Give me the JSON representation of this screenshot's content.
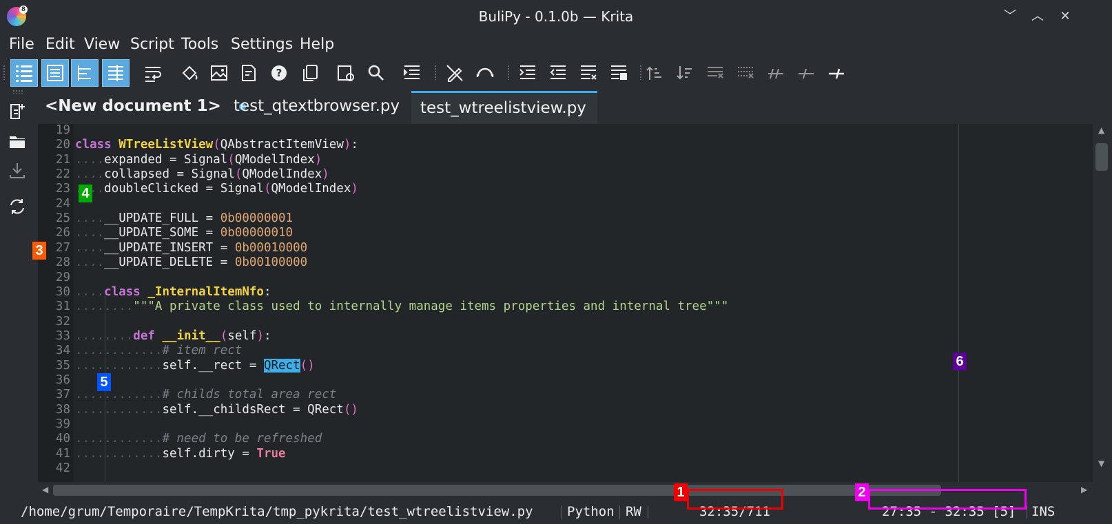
{
  "window": {
    "title": "BuliPy - 0.1.0b — Krita",
    "logo_badge": "8",
    "controls": {
      "minimize": "﹀",
      "maximize": "︿",
      "close": "✕"
    }
  },
  "menu": [
    "File",
    "Edit",
    "View",
    "Script",
    "Tools",
    "Settings",
    "Help"
  ],
  "toolbar": {
    "icons": [
      "outline-view-icon",
      "document-list-icon",
      "structure-view-icon",
      "split-view-icon",
      "word-wrap-icon",
      "paint-bucket-icon",
      "image-icon",
      "document-edit-icon",
      "help-icon",
      "copy-icon",
      "settings-document-icon",
      "search-icon",
      "sort-lines-icon",
      "no-edit-icon",
      "redo-curve-icon",
      "indent-icon",
      "unindent-icon",
      "format-list-icon",
      "format-lines-icon",
      "sort-ascending-icon",
      "sort-descending-icon",
      "remove-lines-icon",
      "remove-whitespace-icon",
      "toggle-comment-icon",
      "comment-icon",
      "uncomment-icon"
    ]
  },
  "sidebar": [
    "new-document-icon",
    "open-folder-icon",
    "download-icon",
    "reload-icon"
  ],
  "tabs": [
    {
      "label": "<New document 1>",
      "modified": true
    },
    {
      "label": "test_qtextbrowser.py",
      "modified": false
    },
    {
      "label": "test_wtreelistview.py",
      "modified": false
    }
  ],
  "editor": {
    "lines": [
      {
        "n": "19",
        "text": ""
      },
      {
        "n": "20",
        "text": "class WTreeListView(QAbstractItemView):"
      },
      {
        "n": "21",
        "text": "....expanded = Signal(QModelIndex)"
      },
      {
        "n": "22",
        "text": "....collapsed = Signal(QModelIndex)"
      },
      {
        "n": "23",
        "text": "....doubleClicked = Signal(QModelIndex)"
      },
      {
        "n": "24",
        "text": ""
      },
      {
        "n": "25",
        "text": "....__UPDATE_FULL = 0b00000001"
      },
      {
        "n": "26",
        "text": "....__UPDATE_SOME = 0b00000010"
      },
      {
        "n": "27",
        "text": "....__UPDATE_INSERT = 0b00010000"
      },
      {
        "n": "28",
        "text": "....__UPDATE_DELETE = 0b00100000"
      },
      {
        "n": "29",
        "text": ""
      },
      {
        "n": "30",
        "text": "....class _InternalItemNfo:"
      },
      {
        "n": "31",
        "text": "........\"\"\"A private class used to internally manage items properties and internal tree\"\"\""
      },
      {
        "n": "32",
        "text": ""
      },
      {
        "n": "33",
        "text": "........def __init__(self):"
      },
      {
        "n": "34",
        "text": "............# item rect"
      },
      {
        "n": "35",
        "text": "............self.__rect = QRect()"
      },
      {
        "n": "36",
        "text": ""
      },
      {
        "n": "37",
        "text": "............# childs total area rect"
      },
      {
        "n": "38",
        "text": "............self.__childsRect = QRect()"
      },
      {
        "n": "39",
        "text": ""
      },
      {
        "n": "40",
        "text": "............# need to be refreshed"
      },
      {
        "n": "41",
        "text": "............self.dirty = True"
      },
      {
        "n": "42",
        "text": ""
      }
    ]
  },
  "status": {
    "path": "/home/grum/Temporaire/TempKrita/tmp_pykrita/test_wtreelistview.py",
    "language": "Python",
    "mode": "RW",
    "cursor": "32:35/711",
    "selection": "27:35 - 32:35 [5]",
    "insert": "INS"
  },
  "markers": [
    {
      "label": "1",
      "color": "#ee0000"
    },
    {
      "label": "2",
      "color": "#ee00ee"
    },
    {
      "label": "3",
      "color": "#ff5a00"
    },
    {
      "label": "4",
      "color": "#00aa00"
    },
    {
      "label": "5",
      "color": "#0055ff"
    },
    {
      "label": "6",
      "color": "#5a0099"
    }
  ]
}
